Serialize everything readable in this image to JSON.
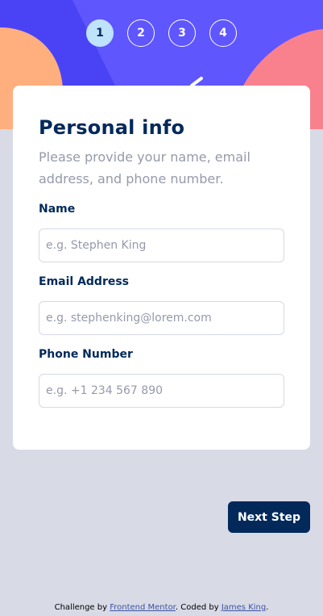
{
  "colors": {
    "hero_background": "#4a43f5",
    "hero_blob_orange": "#ffaf7e",
    "hero_blob_pink": "#f9818e",
    "page_background": "#d8dae6",
    "marine_blue": "#02295a",
    "active_step": "#bfe2fd",
    "muted_text": "#9699ab",
    "border": "#d6d9e6"
  },
  "steps": [
    {
      "number": "1",
      "active": true
    },
    {
      "number": "2",
      "active": false
    },
    {
      "number": "3",
      "active": false
    },
    {
      "number": "4",
      "active": false
    }
  ],
  "form": {
    "title": "Personal info",
    "subtitle": "Please provide your name, email address, and phone number.",
    "fields": [
      {
        "label": "Name",
        "placeholder": "e.g. Stephen King",
        "value": ""
      },
      {
        "label": "Email Address",
        "placeholder": "e.g. stephenking@lorem.com",
        "value": ""
      },
      {
        "label": "Phone Number",
        "placeholder": "e.g. +1 234 567 890",
        "value": ""
      }
    ]
  },
  "actions": {
    "next_label": "Next Step"
  },
  "footer": {
    "prefix": "Challenge by ",
    "link1": "Frontend Mentor",
    "middle": ". Coded by ",
    "link2": "James King",
    "suffix": "."
  }
}
